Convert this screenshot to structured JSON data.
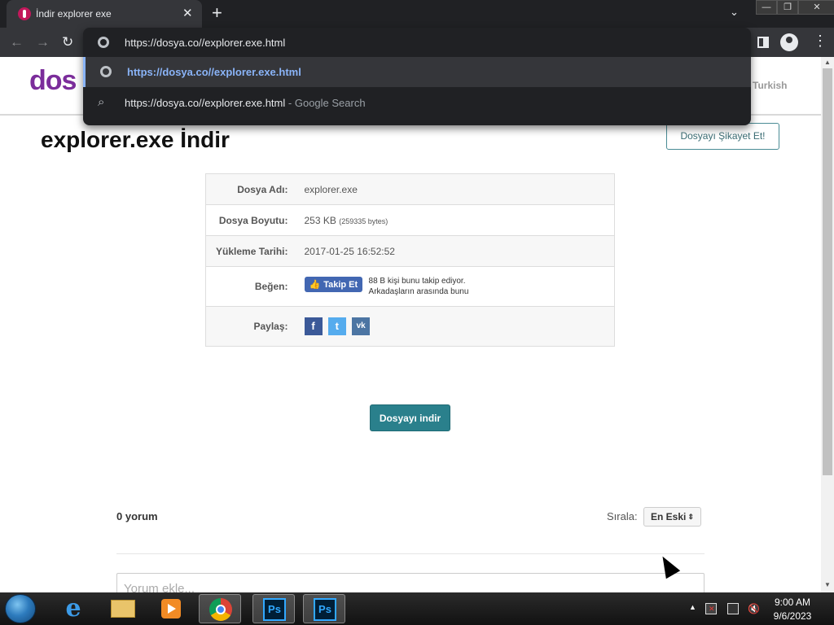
{
  "browser": {
    "tab_title": "İndir explorer exe",
    "tab_close": "✕",
    "new_tab": "+",
    "tab_list": "⌄",
    "window_buttons": {
      "minimize": "—",
      "maximize": "❐",
      "close": "✕"
    },
    "nav": {
      "back": "←",
      "forward": "→",
      "reload": "↻",
      "menu": "⋮"
    },
    "omnibox": {
      "input_value": "https://dosya.co//explorer.exe.html",
      "suggestions": [
        {
          "text": "https://dosya.co//explorer.exe.html",
          "icon": "globe-icon",
          "selected": true
        },
        {
          "text": "https://dosya.co//explorer.exe.html",
          "subtext": "- Google Search",
          "icon": "search-icon",
          "selected": false
        }
      ]
    }
  },
  "site": {
    "logo_text": "dos",
    "language_link": "Turkish"
  },
  "page": {
    "title": "explorer.exe İndir",
    "complaint_button": "Dosyayı Şikayet Et!",
    "info": {
      "file_name_label": "Dosya Adı:",
      "file_name": "explorer.exe",
      "file_size_label": "Dosya Boyutu:",
      "file_size": "253 KB",
      "file_size_bytes": "(259335 bytes)",
      "upload_date_label": "Yükleme Tarihi:",
      "upload_date": "2017-01-25 16:52:52",
      "like_label": "Beğen:",
      "follow_button": "Takip Et",
      "follow_count_text": "88 B kişi bunu takip ediyor.",
      "follow_friends_text": "Arkadaşların arasında bunu",
      "share_label": "Paylaş:",
      "share_icons": [
        "facebook-icon",
        "twitter-icon",
        "vk-icon"
      ]
    },
    "download_button": "Dosyayı indir",
    "comments": {
      "count_text": "0 yorum",
      "sort_label": "Sırala:",
      "sort_value": "En Eski",
      "input_placeholder": "Yorum ekle..."
    }
  },
  "taskbar": {
    "apps": [
      "internet-explorer-icon",
      "file-explorer-icon",
      "media-player-icon",
      "chrome-icon",
      "photoshop-icon",
      "photoshop-icon"
    ],
    "clock_time": "9:00 AM",
    "clock_date": "9/6/2023"
  },
  "colors": {
    "chrome_dark": "#202124",
    "omnibox_highlight": "#8ab4f8",
    "download_button": "#2a808c",
    "logo": "#7b2d9b",
    "facebook_blue": "#4267b2"
  }
}
